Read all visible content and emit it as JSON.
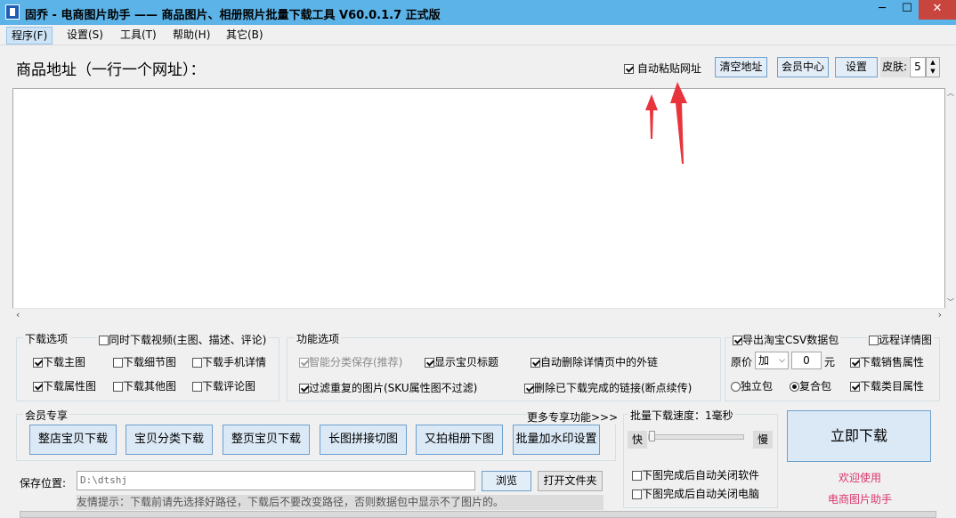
{
  "window": {
    "title": "固乔 - 电商图片助手 —— 商品图片、相册照片批量下载工具 V60.0.1.7 正式版",
    "min_glyph": "─",
    "max_glyph": "☐",
    "close_glyph": "✕"
  },
  "menu": {
    "items": [
      {
        "label": "程序(F)"
      },
      {
        "label": "设置(S)"
      },
      {
        "label": "工具(T)"
      },
      {
        "label": "帮助(H)"
      },
      {
        "label": "其它(B)"
      }
    ]
  },
  "toolbar": {
    "url_label": "商品地址（一行一个网址）：",
    "auto_paste_label": "自动粘贴网址",
    "auto_paste_checked": true,
    "clear_button": "清空地址",
    "member_center_button": "会员中心",
    "settings_button": "设置",
    "skin_label": "皮肤:",
    "skin_value": "5"
  },
  "download_options": {
    "title": "下载选项",
    "video_label": "同时下载视频(主图、描述、评论)",
    "video_checked": false,
    "items": [
      {
        "label": "下载主图",
        "checked": true
      },
      {
        "label": "下载细节图",
        "checked": false
      },
      {
        "label": "下载手机详情",
        "checked": false
      },
      {
        "label": "下载属性图",
        "checked": true
      },
      {
        "label": "下载其他图",
        "checked": false
      },
      {
        "label": "下载评论图",
        "checked": false
      }
    ]
  },
  "function_options": {
    "title": "功能选项",
    "items": [
      {
        "label": "智能分类保存(推荐)",
        "checked": true,
        "disabled": true
      },
      {
        "label": "显示宝贝标题",
        "checked": true
      },
      {
        "label": "自动删除详情页中的外链",
        "checked": true
      },
      {
        "label": "过滤重复的图片(SKU属性图不过滤)",
        "checked": true
      },
      {
        "label": "删除已下载完成的链接(断点续传)",
        "checked": true
      }
    ]
  },
  "csv_options": {
    "export_label": "导出淘宝CSV数据包",
    "export_checked": true,
    "remote_label": "远程详情图",
    "remote_checked": false,
    "price_label": "原价",
    "price_op": "加",
    "price_value": "0",
    "price_unit": "元",
    "sales_attr_label": "下载销售属性",
    "sales_attr_checked": true,
    "radio_single": "独立包",
    "radio_combined": "复合包",
    "selected_pack": "复合包",
    "category_attr_label": "下载类目属性",
    "category_attr_checked": true
  },
  "member": {
    "title": "会员专享",
    "more_link": "更多专享功能>>>",
    "buttons": [
      "整店宝贝下载",
      "宝贝分类下载",
      "整页宝贝下载",
      "长图拼接切图",
      "又拍相册下图",
      "批量加水印设置"
    ]
  },
  "speed": {
    "title": "批量下载速度：1毫秒",
    "fast_label": "快",
    "slow_label": "慢",
    "level": 0,
    "close_app_label": "下图完成后自动关闭软件",
    "close_app_checked": false,
    "shutdown_label": "下图完成后自动关闭电脑",
    "shutdown_checked": false
  },
  "actions": {
    "download_now": "立即下载",
    "welcome_line1": "欢迎使用",
    "welcome_line2": "电商图片助手",
    "welcome_color": "#d9366b"
  },
  "save": {
    "label": "保存位置:",
    "path": "D:\\dtshj",
    "browse_button": "浏览",
    "open_folder_button": "打开文件夹",
    "tip": "友情提示：下载前请先选择好路径，下载后不要改变路径，否则数据包中显示不了图片的。"
  },
  "colors": {
    "titlebar": "#5cb3e8",
    "close": "#c8453d",
    "annotation_arrow": "#e8343b"
  }
}
